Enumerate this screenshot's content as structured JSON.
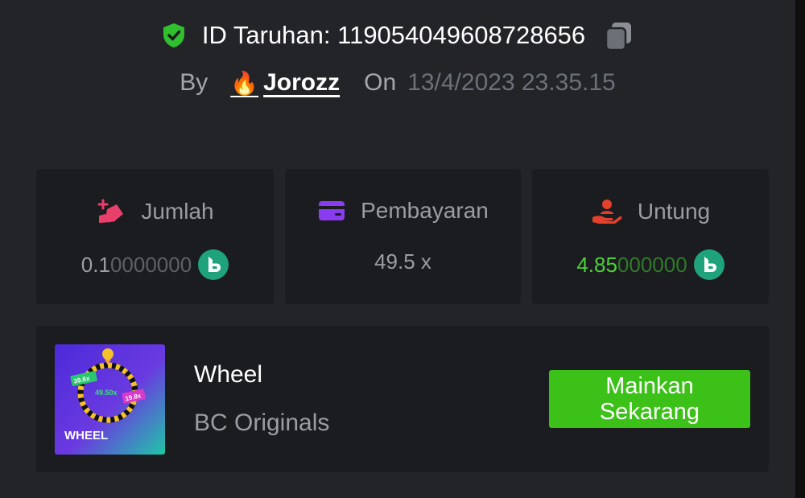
{
  "header": {
    "bet_id_label": "ID Taruhan: 119054049608728656",
    "by_label": "By",
    "username": "Jorozz",
    "on_label": "On",
    "date": "13/4/2023 23.35.15"
  },
  "stats": [
    {
      "icon": "money-bag-icon",
      "label": "Jumlah",
      "value_bright": "0.1",
      "value_dim": "0000000",
      "coin": "bc-coin-icon"
    },
    {
      "icon": "wallet-card-icon",
      "label": "Pembayaran",
      "value": "49.5 x"
    },
    {
      "icon": "profit-hand-icon",
      "label": "Untung",
      "value_bright": "4.85",
      "value_dim": "000000",
      "coin": "bc-coin-icon"
    }
  ],
  "game": {
    "thumbnail_icon": "wheel-game-thumbnail",
    "thumb_label": "WHEEL",
    "thumb_mult_a": "39.6x",
    "thumb_mult_b": "49.50x",
    "thumb_mult_c": "19.8x",
    "name": "Wheel",
    "provider": "BC Originals",
    "play_label": "Mainkan Sekarang"
  },
  "colors": {
    "background": "#232427",
    "card": "#1b1c1f",
    "accent_green": "#3bc117",
    "profit_green": "#4cd137",
    "shield_green": "#2fbf2f"
  }
}
